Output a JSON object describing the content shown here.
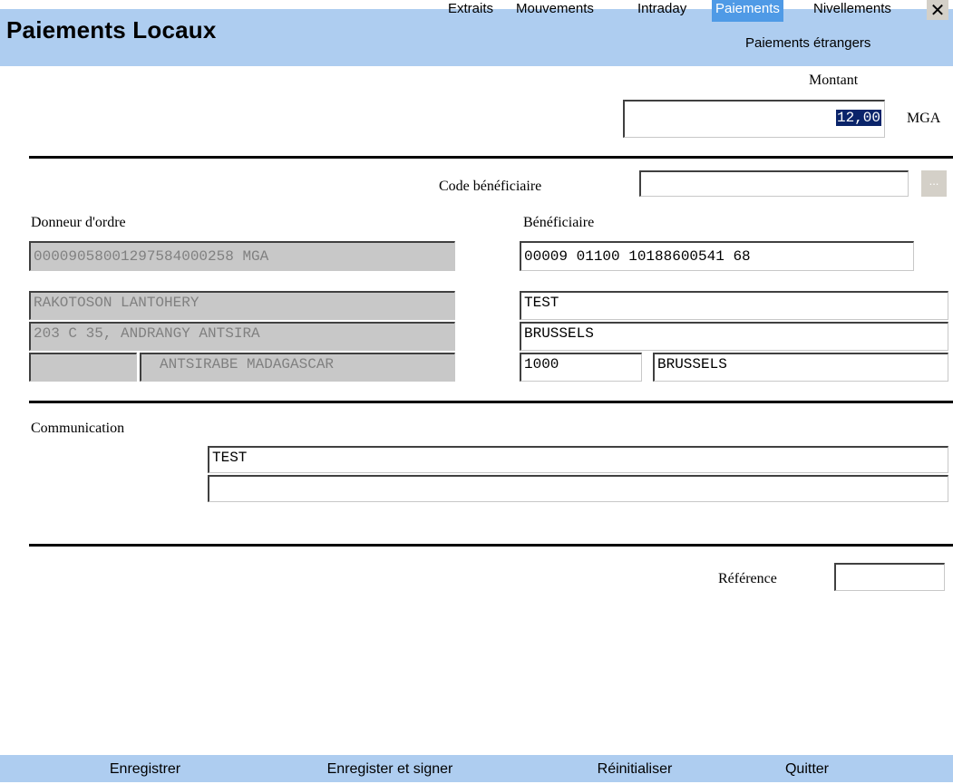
{
  "header": {
    "title": "Paiements Locaux",
    "nav": [
      "Extraits",
      "Mouvements",
      "Intraday",
      "Paiements",
      "Nivellements"
    ],
    "nav_active": "Paiements",
    "subnav": "Paiements étrangers",
    "close_icon": "close-icon",
    "colors": {
      "bar": "#aecdf0",
      "active": "#4f9ae6"
    }
  },
  "amount": {
    "label": "Montant",
    "value": "12,00",
    "currency": "MGA"
  },
  "beneficiary_code": {
    "label": "Code bénéficiaire",
    "value": "",
    "browse_label": "..."
  },
  "orderer": {
    "label": "Donneur d'ordre",
    "account": "00009058001297584000258 MGA",
    "name": "RAKOTOSON LANTOHERY",
    "address": "203 C 35, ANDRANGY ANTSIRA",
    "postal_code": "",
    "city": "ANTSIRABE MADAGASCAR"
  },
  "beneficiary": {
    "label": "Bénéficiaire",
    "account": "00009 01100 10188600541 68",
    "name": "TEST",
    "address": "BRUSSELS",
    "postal_code": "1000",
    "city": "BRUSSELS"
  },
  "communication": {
    "label": "Communication",
    "line1": "TEST",
    "line2": ""
  },
  "reference": {
    "label": "Référence",
    "value": ""
  },
  "footer": {
    "save": "Enregistrer",
    "save_sign": "Enregister et signer",
    "reset": "Réinitialiser",
    "quit": "Quitter"
  }
}
